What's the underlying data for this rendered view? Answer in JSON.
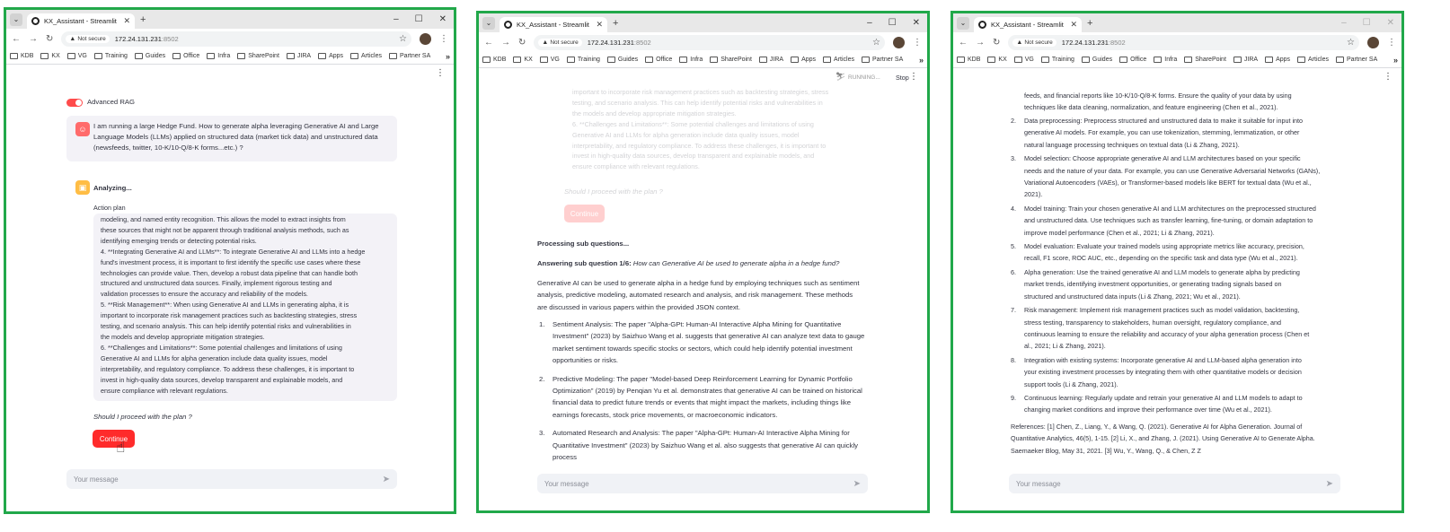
{
  "browser": {
    "tab_title": "KX_Assistant - Streamlit",
    "not_secure": "Not secure",
    "url_host": "172.24.131.231",
    "url_port": ":8502",
    "bookmarks": [
      "KDB",
      "KX",
      "VG",
      "Training",
      "Guides",
      "Office",
      "Infra",
      "SharePoint",
      "JIRA",
      "Apps",
      "Articles",
      "Partner SA"
    ],
    "more_bookmarks": "»",
    "win_controls": [
      "–",
      "☐",
      "✕"
    ],
    "new_tab": "+",
    "tab_close": "✕"
  },
  "panel1": {
    "toggle_label": "Advanced RAG",
    "user_message": "I am running a large Hedge Fund. How to generate alpha leveraging Generative AI and Large Language Models (LLMs) applied on structured data (market tick data) and unstructured data (newsfeeds, twitter, 10-K/10-Q/8-K forms...etc.) ?",
    "status": "Analyzing...",
    "plan_label": "Action plan",
    "plan_lines": [
      "modeling, and named entity recognition. This allows the model to extract insights from",
      "these sources that might not be apparent through traditional analysis methods, such as",
      "identifying emerging trends or detecting potential risks.",
      "4. **Integrating Generative AI and LLMs**: To integrate Generative AI and LLMs into a hedge",
      "fund's investment process, it is important to first identify the specific use cases where these",
      "technologies can provide value. Then, develop a robust data pipeline that can handle both",
      "structured and unstructured data sources. Finally, implement rigorous testing and",
      "validation processes to ensure the accuracy and reliability of the models.",
      "5. **Risk Management**: When using Generative AI and LLMs in generating alpha, it is",
      "important to incorporate risk management practices such as backtesting strategies, stress",
      "testing, and scenario analysis. This can help identify potential risks and vulnerabilities in",
      "the models and develop appropriate mitigation strategies.",
      "6. **Challenges and Limitations**: Some potential challenges and limitations of using",
      "Generative AI and LLMs for alpha generation include data quality issues, model",
      "interpretability, and regulatory compliance. To address these challenges, it is important to",
      "invest in high-quality data sources, develop transparent and explainable models, and",
      "ensure compliance with relevant regulations."
    ],
    "question": "Should I proceed with the plan ?",
    "continue_label": "Continue",
    "input_placeholder": "Your message"
  },
  "panel2": {
    "running": "RUNNING...",
    "stop": "Stop",
    "faded_lines": [
      "important to incorporate risk management practices such as backtesting strategies, stress",
      "testing, and scenario analysis. This can help identify potential risks and vulnerabilities in",
      "the models and develop appropriate mitigation strategies.",
      "6. **Challenges and Limitations**: Some potential challenges and limitations of using",
      "Generative AI and LLMs for alpha generation include data quality issues, model",
      "interpretability, and regulatory compliance. To address these challenges, it is important to",
      "invest in high-quality data sources, develop transparent and explainable models, and",
      "ensure compliance with relevant regulations."
    ],
    "faded_question": "Should I proceed with the plan ?",
    "faded_continue": "Continue",
    "processing": "Processing sub questions...",
    "answering_bold": "Answering sub question 1/6:",
    "answering_italic": "How can Generative AI be used to generate alpha in a hedge fund?",
    "intro_lines": [
      "Generative AI can be used to generate alpha in a hedge fund by employing techniques such as sentiment",
      "analysis, predictive modeling, automated research and analysis, and risk management. These methods",
      "are discussed in various papers within the provided JSON context."
    ],
    "items": [
      {
        "num": "1.",
        "lines": [
          "Sentiment Analysis: The paper \"Alpha-GPt: Human-AI Interactive Alpha Mining for Quantitative",
          "Investment\" (2023) by Saizhuo Wang et al. suggests that generative AI can analyze text data to gauge",
          "market sentiment towards specific stocks or sectors, which could help identify potential investment",
          "opportunities or risks."
        ]
      },
      {
        "num": "2.",
        "lines": [
          "Predictive Modeling: The paper \"Model-based Deep Reinforcement Learning for Dynamic Portfolio",
          "Optimization\" (2019) by Penqian Yu et al. demonstrates that generative AI can be trained on historical",
          "financial data to predict future trends or events that might impact the markets, including things like",
          "earnings forecasts, stock price movements, or macroeconomic indicators."
        ]
      },
      {
        "num": "3.",
        "lines": [
          "Automated Research and Analysis: The paper \"Alpha-GPt: Human-AI Interactive Alpha Mining for",
          "Quantitative Investment\" (2023) by Saizhuo Wang et al. also suggests that generative AI can quickly",
          "process"
        ]
      }
    ],
    "input_placeholder": "Your message"
  },
  "panel3": {
    "top_lines": [
      "feeds, and financial reports like 10-K/10-Q/8-K forms. Ensure the quality of your data by using",
      "techniques like data cleaning, normalization, and feature engineering (Chen et al., 2021)."
    ],
    "items": [
      {
        "num": "2.",
        "lines": [
          "Data preprocessing: Preprocess structured and unstructured data to make it suitable for input into",
          "generative AI models. For example, you can use tokenization, stemming, lemmatization, or other",
          "natural language processing techniques on textual data (Li & Zhang, 2021)."
        ]
      },
      {
        "num": "3.",
        "lines": [
          "Model selection: Choose appropriate generative AI and LLM architectures based on your specific",
          "needs and the nature of your data. For example, you can use Generative Adversarial Networks (GANs),",
          "Variational Autoencoders (VAEs), or Transformer-based models like BERT for textual data (Wu et al.,",
          "2021)."
        ]
      },
      {
        "num": "4.",
        "lines": [
          "Model training: Train your chosen generative AI and LLM architectures on the preprocessed structured",
          "and unstructured data. Use techniques such as transfer learning, fine-tuning, or domain adaptation to",
          "improve model performance (Chen et al., 2021; Li & Zhang, 2021)."
        ]
      },
      {
        "num": "5.",
        "lines": [
          "Model evaluation: Evaluate your trained models using appropriate metrics like accuracy, precision,",
          "recall, F1 score, ROC AUC, etc., depending on the specific task and data type (Wu et al., 2021)."
        ]
      },
      {
        "num": "6.",
        "lines": [
          "Alpha generation: Use the trained generative AI and LLM models to generate alpha by predicting",
          "market trends, identifying investment opportunities, or generating trading signals based on",
          "structured and unstructured data inputs (Li & Zhang, 2021; Wu et al., 2021)."
        ]
      },
      {
        "num": "7.",
        "lines": [
          "Risk management: Implement risk management practices such as model validation, backtesting,",
          "stress testing, transparency to stakeholders, human oversight, regulatory compliance, and",
          "continuous learning to ensure the reliability and accuracy of your alpha generation process (Chen et",
          "al., 2021; Li & Zhang, 2021)."
        ]
      },
      {
        "num": "8.",
        "lines": [
          "Integration with existing systems: Incorporate generative AI and LLM-based alpha generation into",
          "your existing investment processes by integrating them with other quantitative models or decision",
          "support tools (Li & Zhang, 2021)."
        ]
      },
      {
        "num": "9.",
        "lines": [
          "Continuous learning: Regularly update and retrain your generative AI and LLM models to adapt to",
          "changing market conditions and improve their performance over time (Wu et al., 2021)."
        ]
      }
    ],
    "references_lines": [
      "References: [1] Chen, Z., Liang, Y., & Wang, Q. (2021). Generative AI for Alpha Generation. Journal of",
      "Quantitative Analytics, 46(5), 1-15. [2] Li, X., and Zhang, J. (2021). Using Generative AI to Generate Alpha.",
      "Saemaeker Blog, May 31, 2021. [3] Wu, Y., Wang, Q., & Chen, Z Z"
    ],
    "input_placeholder": "Your message"
  },
  "colors": {
    "frame": "#21a84a",
    "accent": "#ff2b2b",
    "toggle": "#ff4b4b"
  }
}
